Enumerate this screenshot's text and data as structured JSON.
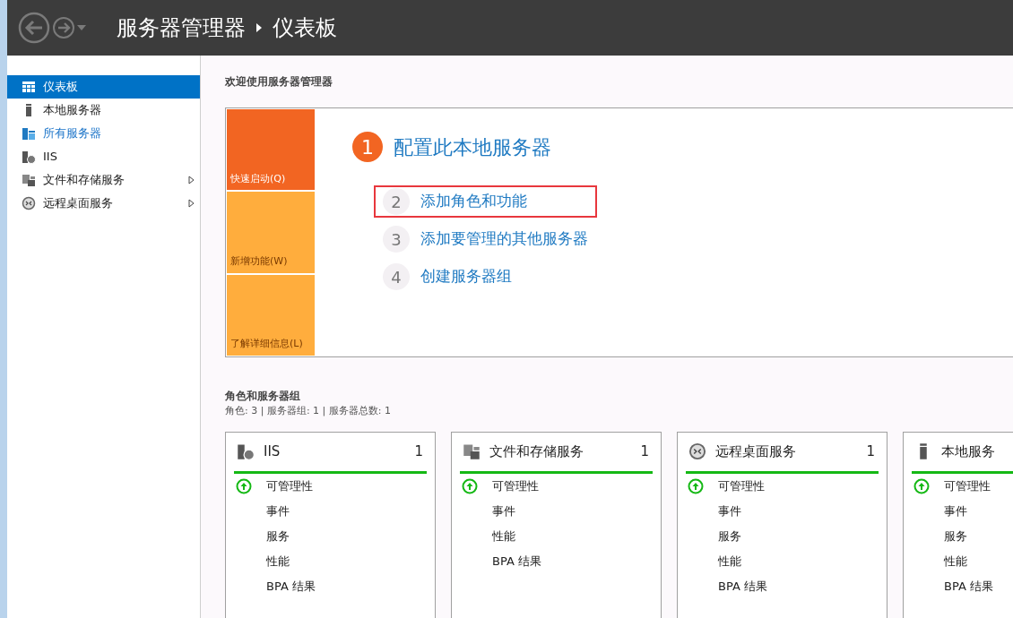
{
  "window": {
    "title": "服务器管理器",
    "page": "仪表板"
  },
  "sidebar": {
    "items": [
      {
        "label": "仪表板",
        "kind": "dashboard",
        "selected": true,
        "hovered": false,
        "expandable": false
      },
      {
        "label": "本地服务器",
        "kind": "server",
        "selected": false,
        "hovered": false,
        "expandable": false
      },
      {
        "label": "所有服务器",
        "kind": "servers",
        "selected": false,
        "hovered": true,
        "expandable": false
      },
      {
        "label": "IIS",
        "kind": "iis",
        "selected": false,
        "hovered": false,
        "expandable": false
      },
      {
        "label": "文件和存储服务",
        "kind": "files",
        "selected": false,
        "hovered": false,
        "expandable": true
      },
      {
        "label": "远程桌面服务",
        "kind": "remote",
        "selected": false,
        "hovered": false,
        "expandable": true
      }
    ]
  },
  "welcome": {
    "heading": "欢迎使用服务器管理器",
    "tiles": [
      {
        "label": "快速启动(Q)",
        "selected": true
      },
      {
        "label": "新增功能(W)",
        "selected": false
      },
      {
        "label": "了解详细信息(L)",
        "selected": false
      }
    ],
    "steps": [
      {
        "number": "1",
        "label": "配置此本地服务器",
        "primary": true,
        "highlighted": false
      },
      {
        "number": "2",
        "label": "添加角色和功能",
        "primary": false,
        "highlighted": true
      },
      {
        "number": "3",
        "label": "添加要管理的其他服务器",
        "primary": false,
        "highlighted": false
      },
      {
        "number": "4",
        "label": "创建服务器组",
        "primary": false,
        "highlighted": false
      }
    ]
  },
  "roles": {
    "heading": "角色和服务器组",
    "summary": "角色: 3 | 服务器组: 1 | 服务器总数: 1",
    "cards": [
      {
        "title": "IIS",
        "kind": "iis",
        "count": "1",
        "rows": [
          {
            "label": "可管理性",
            "healthy": true
          },
          {
            "label": "事件",
            "healthy": false
          },
          {
            "label": "服务",
            "healthy": false
          },
          {
            "label": "性能",
            "healthy": false
          },
          {
            "label": "BPA 结果",
            "healthy": false
          }
        ]
      },
      {
        "title": "文件和存储服务",
        "kind": "files",
        "count": "1",
        "rows": [
          {
            "label": "可管理性",
            "healthy": true
          },
          {
            "label": "事件",
            "healthy": false
          },
          {
            "label": "性能",
            "healthy": false
          },
          {
            "label": "BPA 结果",
            "healthy": false
          }
        ]
      },
      {
        "title": "远程桌面服务",
        "kind": "remote",
        "count": "1",
        "rows": [
          {
            "label": "可管理性",
            "healthy": true
          },
          {
            "label": "事件",
            "healthy": false
          },
          {
            "label": "服务",
            "healthy": false
          },
          {
            "label": "性能",
            "healthy": false
          },
          {
            "label": "BPA 结果",
            "healthy": false
          }
        ]
      },
      {
        "title": "本地服务",
        "kind": "server",
        "rows": [
          {
            "label": "可管理性",
            "healthy": true
          },
          {
            "label": "事件",
            "healthy": false
          },
          {
            "label": "服务",
            "healthy": false
          },
          {
            "label": "性能",
            "healthy": false
          },
          {
            "label": "BPA 结果",
            "healthy": false
          }
        ]
      }
    ]
  }
}
